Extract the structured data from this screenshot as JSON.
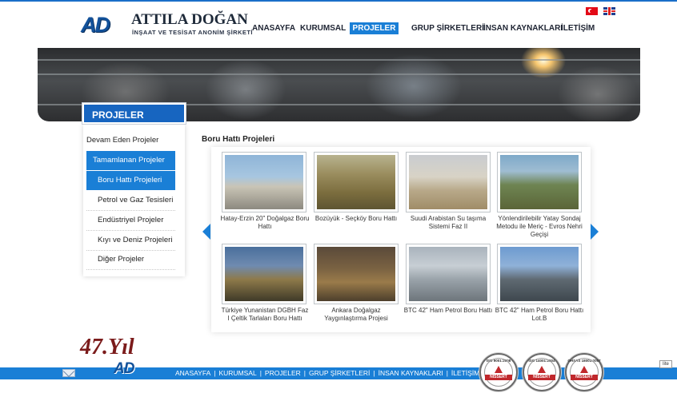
{
  "header": {
    "logo": {
      "mark": "AD",
      "name": "ATTILA DOĞAN",
      "subtitle": "İNŞAAT VE TESİSAT ANONİM ŞİRKETİ"
    },
    "languages": [
      {
        "code": "tr",
        "icon": "turkish-flag-icon"
      },
      {
        "code": "en",
        "icon": "uk-flag-icon"
      }
    ],
    "nav": [
      {
        "label": "ANASAYFA"
      },
      {
        "label": "KURUMSAL"
      },
      {
        "label": "PROJELER",
        "active": true
      },
      {
        "label": "GRUP ŞİRKETLERİ"
      },
      {
        "label": "İNSAN KAYNAKLARI"
      },
      {
        "label": "İLETİŞİM"
      }
    ]
  },
  "sidebar": {
    "title": "PROJELER",
    "items": [
      {
        "label": "Devam Eden Projeler"
      },
      {
        "label": "Tamamlanan Projeler",
        "active": true
      },
      {
        "label": "Boru Hattı Projeleri",
        "active": true
      },
      {
        "label": "Petrol ve Gaz Tesisleri"
      },
      {
        "label": "Endüstriyel Projeler"
      },
      {
        "label": "Kıyı ve Deniz Projeleri"
      },
      {
        "label": "Diğer Projeler"
      }
    ]
  },
  "content": {
    "title": "Boru Hattı Projeleri",
    "projects": [
      {
        "caption": "Hatay-Erzin 20\" Doğalgaz Boru Hattı"
      },
      {
        "caption": "Bozüyük - Seçköy Boru Hattı"
      },
      {
        "caption": "Suudi Arabistan Su taşıma Sistemi Faz II"
      },
      {
        "caption": "Yönlendirilebilir Yatay Sondaj Metodu ile Meriç - Evros Nehri Geçişi"
      },
      {
        "caption": "Türkiye Yunanistan DGBH Faz I Çeltik Tarlaları Boru Hattı"
      },
      {
        "caption": "Ankara Doğalgaz Yaygınlaştırma Projesi"
      },
      {
        "caption": "BTC 42\" Ham Petrol Boru Hattı"
      },
      {
        "caption": "BTC 42\" Ham Petrol Boru Hattı Lot.B"
      }
    ]
  },
  "footer": {
    "anniversary": "47.Yıl",
    "mark": "AD",
    "links": [
      "ANASAYFA",
      "KURUMSAL",
      "PROJELER",
      "GRUP ŞİRKETLERİ",
      "İNSAN KAYNAKLARI",
      "İLETİŞİM"
    ],
    "separator": "|",
    "certifications": [
      {
        "standard": "ISO 9001:2008",
        "issuer": "NISSERT"
      },
      {
        "standard": "ISO 14001:2004",
        "issuer": "NISSERT"
      },
      {
        "standard": "OHSAS 18001:2007",
        "issuer": "NISSERT"
      }
    ],
    "badge": "lite"
  }
}
